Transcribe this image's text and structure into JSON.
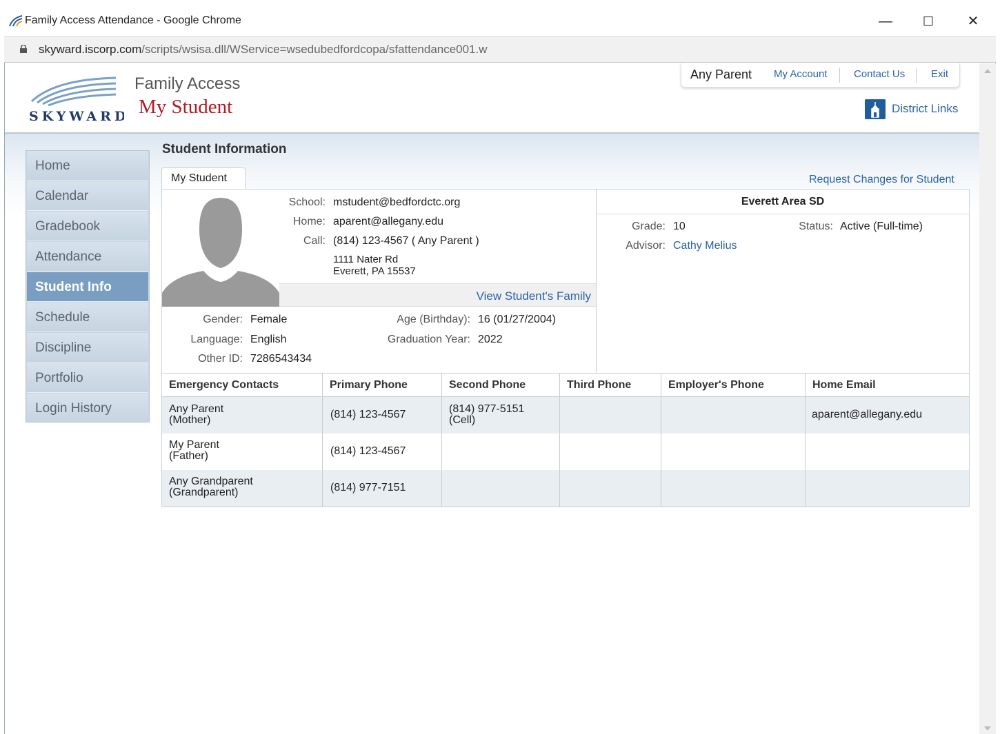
{
  "browser": {
    "window_title": "Family Access Attendance - Google Chrome",
    "url_host": "skyward.iscorp.com",
    "url_path": "/scripts/wsisa.dll/WService=wsedubedfordcopa/sfattendance001.w",
    "minimize": "—",
    "maximize": "☐",
    "close": "✕"
  },
  "header": {
    "logo_text": "SKYWARD",
    "family_access": "Family Access",
    "my_student": "My Student",
    "user_name": "Any Parent",
    "my_account": "My Account",
    "contact_us": "Contact Us",
    "exit": "Exit",
    "district_links": "District Links"
  },
  "nav": {
    "items": [
      {
        "label": "Home"
      },
      {
        "label": "Calendar"
      },
      {
        "label": "Gradebook"
      },
      {
        "label": "Attendance"
      },
      {
        "label": "Student Info"
      },
      {
        "label": "Schedule"
      },
      {
        "label": "Discipline"
      },
      {
        "label": "Portfolio"
      },
      {
        "label": "Login History"
      }
    ],
    "active_index": 4
  },
  "main": {
    "section_title": "Student Information",
    "tab_label": "My Student",
    "request_changes": "Request Changes for Student",
    "contact": {
      "school_label": "School:",
      "school_value": "mstudent@bedfordctc.org",
      "home_label": "Home:",
      "home_value": "aparent@allegany.edu",
      "call_label": "Call:",
      "call_value": "(814) 123-4567 ( Any Parent )",
      "address_line1": "1111 Nater Rd",
      "address_line2": "Everett, PA 15537"
    },
    "view_family": "View Student's Family",
    "details": {
      "gender_label": "Gender:",
      "gender_value": "Female",
      "language_label": "Language:",
      "language_value": "English",
      "otherid_label": "Other ID:",
      "otherid_value": "7286543434",
      "age_label": "Age (Birthday):",
      "age_value": "16 (01/27/2004)",
      "grad_label": "Graduation Year:",
      "grad_value": "2022"
    },
    "district": {
      "name": "Everett Area SD",
      "grade_label": "Grade:",
      "grade_value": "10",
      "status_label": "Status:",
      "status_value": "Active (Full-time)",
      "advisor_label": "Advisor:",
      "advisor_value": "Cathy Melius"
    },
    "contacts_table": {
      "headers": [
        "Emergency Contacts",
        "Primary Phone",
        "Second Phone",
        "Third Phone",
        "Employer's Phone",
        "Home Email"
      ],
      "rows": [
        {
          "name": "Any Parent",
          "relation": "(Mother)",
          "primary": "(814) 123-4567",
          "second": "(814) 977-5151",
          "second_type": "(Cell)",
          "third": "",
          "employer": "",
          "email": "aparent@allegany.edu"
        },
        {
          "name": "My Parent",
          "relation": "(Father)",
          "primary": "(814) 123-4567",
          "second": "",
          "second_type": "",
          "third": "",
          "employer": "",
          "email": ""
        },
        {
          "name": "Any Grandparent",
          "relation": "(Grandparent)",
          "primary": "(814) 977-7151",
          "second": "",
          "second_type": "",
          "third": "",
          "employer": "",
          "email": ""
        }
      ]
    }
  },
  "colors": {
    "brand_red": "#b01c22",
    "link_blue": "#2a62a6",
    "nav_active": "#7a9ec2"
  }
}
